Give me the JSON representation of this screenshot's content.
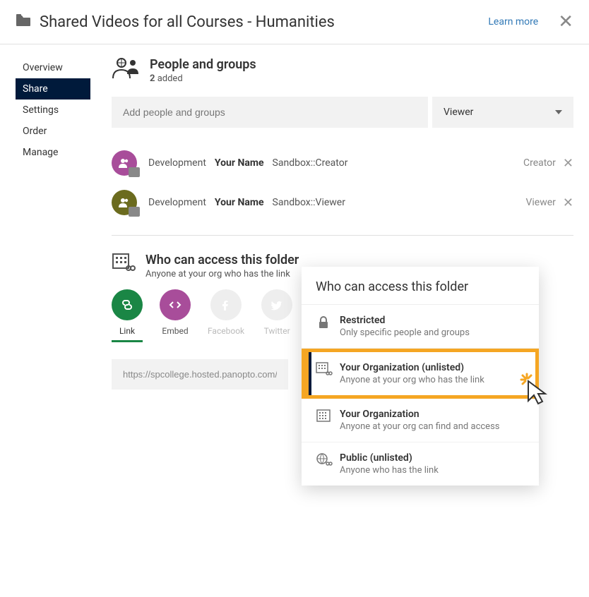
{
  "header": {
    "title": "Shared Videos for all Courses - Humanities",
    "learn_more": "Learn more"
  },
  "sidebar": {
    "items": [
      {
        "label": "Overview"
      },
      {
        "label": "Share"
      },
      {
        "label": "Settings"
      },
      {
        "label": "Order"
      },
      {
        "label": "Manage"
      }
    ]
  },
  "people": {
    "title": "People and groups",
    "count": "2",
    "added_suffix": " added",
    "input_placeholder": "Add people and groups",
    "role_selected": "Viewer",
    "rows": [
      {
        "dev": "Development",
        "name": "Your Name",
        "role_group": "Sandbox::Creator",
        "role_label": "Creator"
      },
      {
        "dev": "Development",
        "name": "Your Name",
        "role_group": "Sandbox::Viewer",
        "role_label": "Viewer"
      }
    ]
  },
  "access": {
    "title": "Who can access this folder",
    "subtitle": "Anyone at your org who has the link",
    "share_options": [
      {
        "label": "Link"
      },
      {
        "label": "Embed"
      },
      {
        "label": "Facebook"
      },
      {
        "label": "Twitter"
      }
    ],
    "url": "https://spcollege.hosted.panopto.com/P"
  },
  "dropdown": {
    "title": "Who can access this folder",
    "options": [
      {
        "title": "Restricted",
        "desc": "Only specific people and groups"
      },
      {
        "title": "Your Organization (unlisted)",
        "desc": "Anyone at your org who has the link"
      },
      {
        "title": "Your Organization",
        "desc": "Anyone at your org can find and access"
      },
      {
        "title": "Public (unlisted)",
        "desc": "Anyone who has the link"
      }
    ]
  }
}
